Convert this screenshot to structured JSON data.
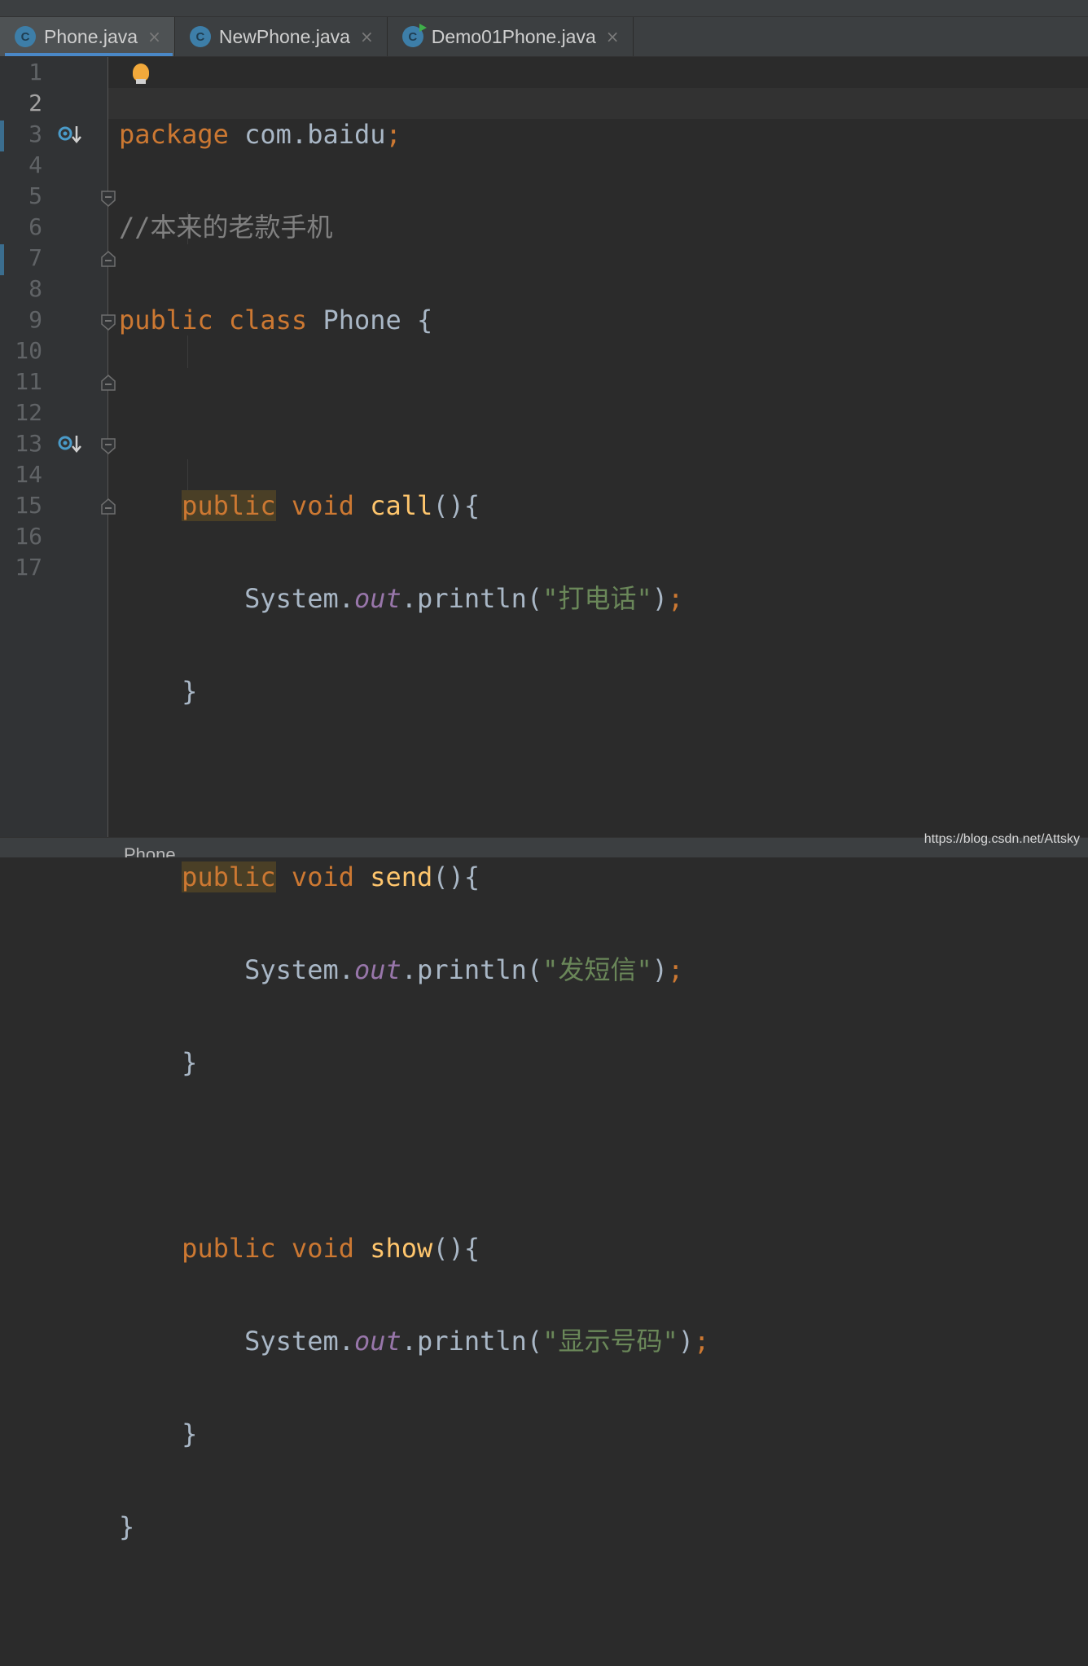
{
  "tabs": [
    {
      "label": "Phone.java",
      "icon": "class-icon",
      "active": true
    },
    {
      "label": "NewPhone.java",
      "icon": "class-icon",
      "active": false
    },
    {
      "label": "Demo01Phone.java",
      "icon": "runnable-class-icon",
      "active": false
    }
  ],
  "tab_close_glyph": "×",
  "tab_icon_letter": "C",
  "current_line": 2,
  "line_numbers": [
    "1",
    "2",
    "3",
    "4",
    "5",
    "6",
    "7",
    "8",
    "9",
    "10",
    "11",
    "12",
    "13",
    "14",
    "15",
    "16",
    "17"
  ],
  "code": {
    "l1": {
      "kw": "package",
      "rest": " com.baidu",
      "semi": ";"
    },
    "l2": {
      "comment": "//本来的老款手机"
    },
    "l3": {
      "kw1": "public",
      "kw2": "class",
      "name": "Phone",
      "brace": "{"
    },
    "l5": {
      "kw1": "public",
      "kw2": "void",
      "fn": "call",
      "rest": "(){"
    },
    "l6": {
      "obj": "System.",
      "field": "out",
      "call": ".println(",
      "str": "\"打电话\"",
      "close": ")",
      "semi": ";"
    },
    "l7": {
      "text": "}"
    },
    "l9": {
      "kw1": "public",
      "kw2": "void",
      "fn": "send",
      "rest": "(){"
    },
    "l10": {
      "obj": "System.",
      "field": "out",
      "call": ".println(",
      "str": "\"发短信\"",
      "close": ")",
      "semi": ";"
    },
    "l11": {
      "text": "}"
    },
    "l13": {
      "kw1": "public",
      "kw2": "void",
      "fn": "show",
      "rest": "(){"
    },
    "l14": {
      "obj": "System.",
      "field": "out",
      "call": ".println(",
      "str": "\"显示号码\"",
      "close": ")",
      "semi": ";"
    },
    "l15": {
      "text": "}"
    },
    "l16": {
      "text": "}"
    }
  },
  "breadcrumb": "Phone",
  "watermark": "https://blog.csdn.net/Attsky",
  "colors": {
    "background": "#2b2b2b",
    "keyword": "#cc7832",
    "function": "#ffc66d",
    "string": "#6a8759",
    "comment": "#808080",
    "field": "#9876aa",
    "text": "#a9b7c6",
    "accent": "#4a88c7"
  }
}
